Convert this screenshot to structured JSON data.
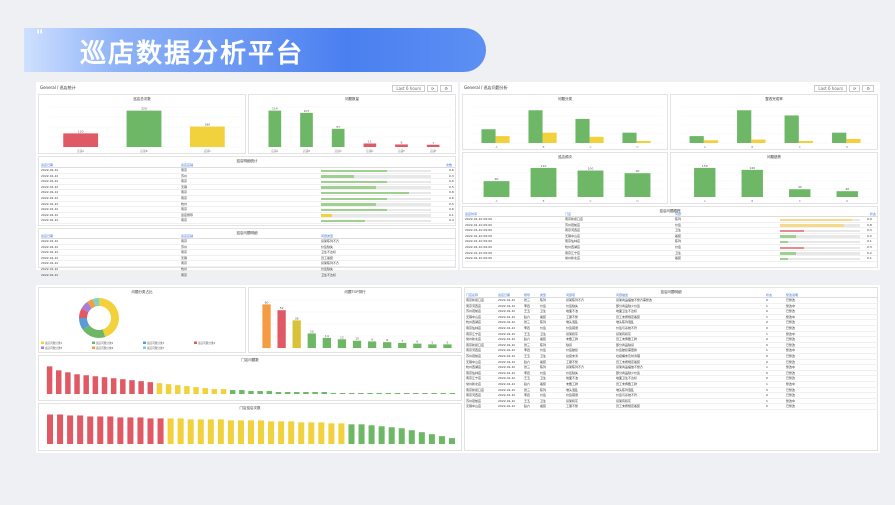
{
  "header": {
    "title": "巡店数据分析平台",
    "mark": "\""
  },
  "panel_top_left": {
    "label": "General / 巡店统计",
    "buttons": [
      "Last 6 hours",
      "⟳",
      "⚙"
    ],
    "chart1": {
      "title": "巡店总次数",
      "categories": [
        "店铺A",
        "店铺B",
        "店铺C"
      ],
      "values": [
        120,
        320,
        180
      ],
      "colors": [
        "#e05a66",
        "#6db767",
        "#f1d23c"
      ]
    },
    "chart2": {
      "title": "问题数量",
      "categories": [
        "店铺A",
        "店铺B",
        "店铺C",
        "店铺D",
        "店铺E",
        "店铺F"
      ],
      "values": [
        114,
        107,
        57,
        11,
        8,
        7
      ],
      "colors": [
        "#6db767",
        "#6db767",
        "#6db767",
        "#e05a66",
        "#e05a66",
        "#e05a66"
      ]
    },
    "table1": {
      "title": "巡店明细统计",
      "headers": [
        "巡店日期",
        "巡店店铺",
        "",
        "次数"
      ],
      "rows": [
        [
          "2022-01-10",
          "南京",
          "0.6"
        ],
        [
          "2022-01-10",
          "苏州",
          "0.3"
        ],
        [
          "2022-01-10",
          "南京",
          "0.6"
        ],
        [
          "2022-01-10",
          "无锡",
          "0.5"
        ],
        [
          "2022-01-10",
          "南京",
          "0.8"
        ],
        [
          "2022-01-10",
          "南京",
          "0.6"
        ],
        [
          "2022-01-10",
          "杭州",
          "0.5"
        ],
        [
          "2022-01-10",
          "南京",
          "0.6"
        ],
        [
          "2022-01-10",
          "巡店督导",
          "0.1"
        ],
        [
          "2022-01-10",
          "南京",
          "0.4"
        ]
      ]
    },
    "table2": {
      "title": "巡店问题明细",
      "headers": [
        "巡店日期",
        "巡店店铺",
        "问题类型"
      ],
      "rows": [
        [
          "2022-01-10",
          "南京",
          "货架陈列不齐"
        ],
        [
          "2022-01-10",
          "苏州",
          "价签缺失"
        ],
        [
          "2022-01-10",
          "南京",
          "卫生不达标"
        ],
        [
          "2022-01-10",
          "无锡",
          "员工着装"
        ],
        [
          "2022-01-10",
          "南京",
          "货架陈列不齐"
        ],
        [
          "2022-01-10",
          "杭州",
          "价签缺失"
        ],
        [
          "2022-01-10",
          "南京",
          "卫生不达标"
        ]
      ]
    }
  },
  "panel_top_right": {
    "label": "General / 巡店问题分析",
    "buttons": [
      "Last 6 hours",
      "⟳",
      "⚙"
    ],
    "chart3": {
      "title": "问题分类",
      "categories": [
        "A",
        "B",
        "C",
        "D"
      ],
      "series": [
        {
          "values": [
            40,
            95,
            70,
            30
          ],
          "color": "#6db767"
        },
        {
          "values": [
            20,
            30,
            18,
            6
          ],
          "color": "#f1d23c"
        }
      ]
    },
    "chart4": {
      "title": "整改完成率",
      "categories": [
        "A",
        "B",
        "C",
        "D"
      ],
      "series": [
        {
          "values": [
            20,
            95,
            80,
            30
          ],
          "color": "#6db767"
        },
        {
          "values": [
            8,
            10,
            6,
            12
          ],
          "color": "#f1d23c"
        }
      ]
    },
    "chart5": {
      "title": "巡店频次",
      "categories": [
        "A",
        "B",
        "C",
        "D"
      ],
      "values": [
        60,
        110,
        100,
        90
      ],
      "color": "#6db767"
    },
    "chart6": {
      "title": "问题趋势",
      "categories": [
        "A",
        "B",
        "C",
        "D"
      ],
      "values": [
        150,
        140,
        40,
        30
      ],
      "color": "#6db767"
    },
    "table3": {
      "title": "巡店问题跟踪",
      "headers": [
        "巡店时间",
        "门店",
        "问题",
        "状态"
      ],
      "rows": [
        [
          "2022-01-10 09:00",
          "南京新街口店",
          "陈列",
          "0.9"
        ],
        [
          "2022-01-10 09:00",
          "苏州观前店",
          "价签",
          "0.8"
        ],
        [
          "2022-01-10 09:00",
          "南京河西店",
          "卫生",
          "0.3"
        ],
        [
          "2022-01-10 09:00",
          "无锡中山店",
          "着装",
          "0.2"
        ],
        [
          "2022-01-10 09:00",
          "南京仙林店",
          "陈列",
          "0.1"
        ],
        [
          "2022-01-10 09:00",
          "杭州西湖店",
          "价签",
          "0.3"
        ],
        [
          "2022-01-10 09:00",
          "南京江宁店",
          "卫生",
          "0.2"
        ],
        [
          "2022-01-10 09:00",
          "常州新北店",
          "着装",
          "0.1"
        ]
      ]
    }
  },
  "panel_bottom": {
    "donut": {
      "title": "问题分类占比",
      "values": [
        45,
        20,
        10,
        8,
        7,
        5,
        5
      ],
      "colors": [
        "#f1d23c",
        "#6db767",
        "#5b9bd5",
        "#e05a66",
        "#a77fd6",
        "#f59b42",
        "#7dd3c8"
      ],
      "legend": [
        "巡店问题分类1",
        "巡店问题分类2",
        "巡店问题分类3",
        "巡店问题分类4",
        "巡店问题分类5",
        "巡店问题分类6",
        "巡店问题分类7"
      ]
    },
    "bars": {
      "title": "问题TOP排行",
      "values": [
        60,
        52,
        38,
        20,
        14,
        12,
        10,
        9,
        8,
        7,
        6,
        5,
        5
      ],
      "colors": [
        "#f59b42",
        "#e05a66",
        "#d9c23a",
        "#6db767",
        "#6db767",
        "#6db767",
        "#6db767",
        "#6db767",
        "#6db767",
        "#6db767",
        "#6db767",
        "#6db767",
        "#6db767"
      ]
    },
    "strip1": {
      "title": "门店问题数",
      "values": [
        28,
        24,
        22,
        20,
        19,
        18,
        17,
        16,
        15,
        14,
        13,
        12,
        11,
        10,
        9,
        8,
        7,
        6,
        5,
        5,
        4,
        4,
        3,
        3,
        3,
        2,
        2,
        2,
        2,
        2,
        2,
        1,
        1,
        1,
        1,
        1,
        1,
        1,
        1,
        1,
        1,
        1,
        1,
        1,
        1
      ]
    },
    "strip2": {
      "title": "门店巡店次数",
      "values": [
        30,
        30,
        29,
        29,
        28,
        28,
        28,
        27,
        27,
        27,
        26,
        26,
        26,
        26,
        25,
        25,
        25,
        25,
        24,
        24,
        24,
        24,
        23,
        23,
        23,
        22,
        22,
        22,
        21,
        21,
        20,
        20,
        19,
        18,
        17,
        16,
        14,
        12,
        10,
        8,
        6
      ]
    },
    "table4": {
      "title": "巡店问题明细",
      "headers": [
        "门店名称",
        "巡店日期",
        "督导",
        "类型",
        "问题项",
        "问题描述",
        "状态",
        "整改说明"
      ],
      "rows": [
        [
          "南京新街口店",
          "2022-01-10",
          "张三",
          "陈列",
          "货架陈列不齐",
          "货架商品摆放不整齐需整改",
          "0",
          "已整改"
        ],
        [
          "南京河西店",
          "2022-01-10",
          "李四",
          "价签",
          "价签缺失",
          "部分商品缺少价签",
          "1",
          "整改中"
        ],
        [
          "苏州观前店",
          "2022-01-10",
          "王五",
          "卫生",
          "地面不洁",
          "地面卫生不达标",
          "0",
          "已整改"
        ],
        [
          "无锡中山店",
          "2022-01-10",
          "赵六",
          "着装",
          "工服不整",
          "员工未按规定着装",
          "1",
          "整改中"
        ],
        [
          "杭州西湖店",
          "2022-01-10",
          "张三",
          "陈列",
          "堆头混乱",
          "堆头陈列混乱",
          "0",
          "已整改"
        ],
        [
          "南京仙林店",
          "2022-01-10",
          "李四",
          "价签",
          "价签错误",
          "价签与系统不符",
          "0",
          "已整改"
        ],
        [
          "南京江宁店",
          "2022-01-10",
          "王五",
          "卫生",
          "货架积灰",
          "货架有积灰",
          "1",
          "整改中"
        ],
        [
          "常州新北店",
          "2022-01-10",
          "赵六",
          "着装",
          "未戴工牌",
          "员工未佩戴工牌",
          "0",
          "已整改"
        ],
        [
          "南京新街口店",
          "2022-01-10",
          "张三",
          "陈列",
          "缺货",
          "部分商品缺货",
          "0",
          "已整改"
        ],
        [
          "南京河西店",
          "2022-01-10",
          "李四",
          "价签",
          "价签破损",
          "价签破损需更换",
          "1",
          "整改中"
        ],
        [
          "苏州观前店",
          "2022-01-10",
          "王五",
          "卫生",
          "垃圾未清",
          "垃圾桶未及时清理",
          "0",
          "已整改"
        ],
        [
          "无锡中山店",
          "2022-01-10",
          "赵六",
          "着装",
          "工服不整",
          "员工未按规定着装",
          "0",
          "已整改"
        ],
        [
          "杭州西湖店",
          "2022-01-10",
          "张三",
          "陈列",
          "货架陈列不齐",
          "货架商品摆放不整齐",
          "1",
          "整改中"
        ],
        [
          "南京仙林店",
          "2022-01-10",
          "李四",
          "价签",
          "价签缺失",
          "部分商品缺少价签",
          "0",
          "已整改"
        ],
        [
          "南京江宁店",
          "2022-01-10",
          "王五",
          "卫生",
          "地面不洁",
          "地面卫生不达标",
          "0",
          "已整改"
        ],
        [
          "常州新北店",
          "2022-01-10",
          "赵六",
          "着装",
          "未戴工牌",
          "员工未佩戴工牌",
          "1",
          "整改中"
        ],
        [
          "南京新街口店",
          "2022-01-10",
          "张三",
          "陈列",
          "堆头混乱",
          "堆头陈列混乱",
          "0",
          "已整改"
        ],
        [
          "南京河西店",
          "2022-01-10",
          "李四",
          "价签",
          "价签错误",
          "价签与系统不符",
          "0",
          "已整改"
        ],
        [
          "苏州观前店",
          "2022-01-10",
          "王五",
          "卫生",
          "货架积灰",
          "货架有积灰",
          "1",
          "整改中"
        ],
        [
          "无锡中山店",
          "2022-01-10",
          "赵六",
          "着装",
          "工服不整",
          "员工未按规定着装",
          "0",
          "已整改"
        ]
      ]
    }
  }
}
